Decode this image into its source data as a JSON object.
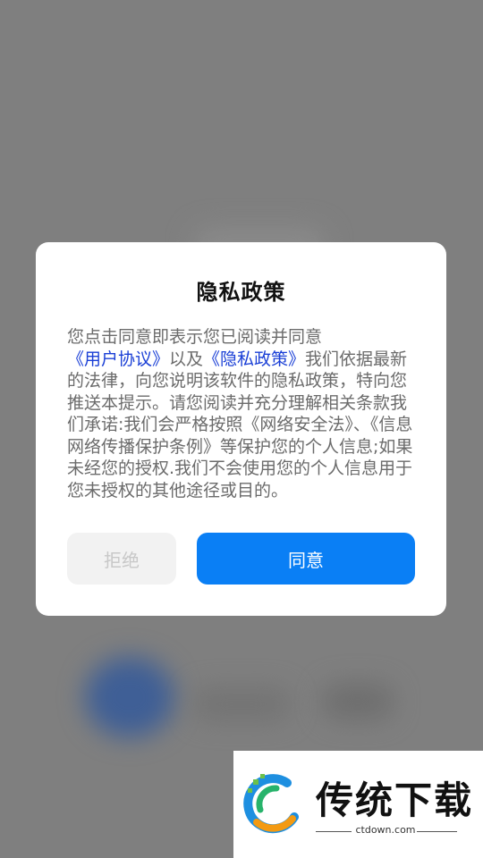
{
  "dialog": {
    "title": "隐私政策",
    "body": {
      "text1": "您点击同意即表示您已阅读并同意",
      "link_user_agreement": "《用户协议》",
      "text2": "以及",
      "link_privacy_policy": "《隐私政策》",
      "text3": "我们依据最新的法律，向您说明该软件的隐私政策，特向您推送本提示。请您阅读并充分理解相关条款我们承诺:我们会严格按照《网络安全法》、《信息网络传播保护条例》等保护您的个人信息;如果未经您的授权.我们不会使用您的个人信息用于您未授权的其他途径或目的。"
    },
    "buttons": {
      "reject_label": "拒绝",
      "agree_label": "同意"
    }
  },
  "watermark": {
    "title": "传统下载",
    "url": "ctdown.com"
  },
  "colors": {
    "overlay": "#7f7f7f",
    "link": "#1a3fd6",
    "primary_button": "#0a7ff5",
    "secondary_button": "#f2f2f2"
  }
}
